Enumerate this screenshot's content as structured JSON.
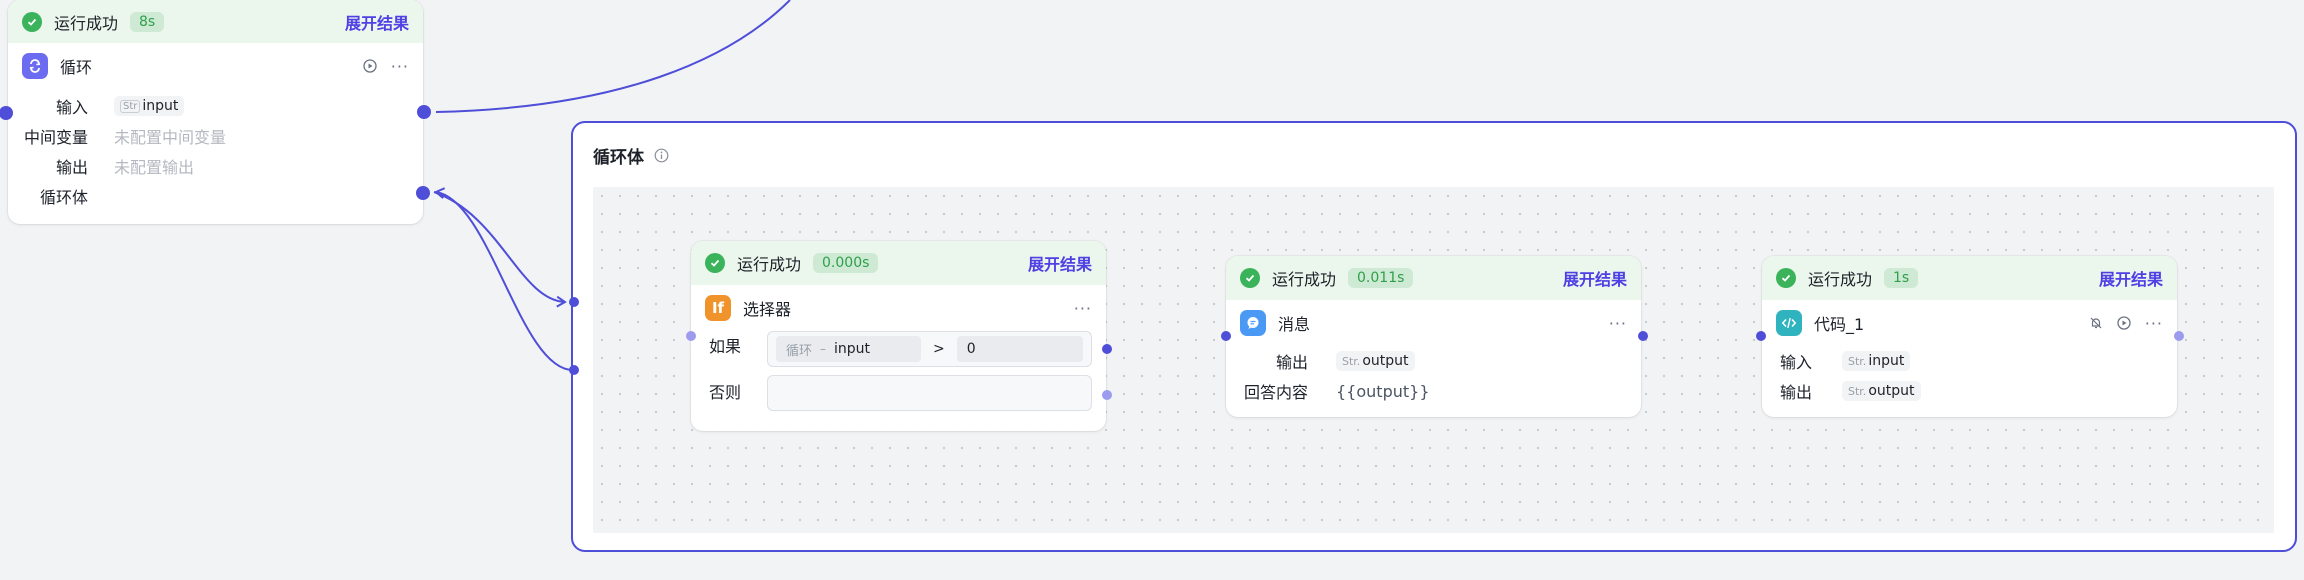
{
  "status": {
    "success_text": "运行成功",
    "expand_label": "展开结果"
  },
  "loop_node": {
    "duration": "8s",
    "title": "循环",
    "rows": {
      "input_label": "输入",
      "input_type": "Str",
      "input_value": "input",
      "mid_label": "中间变量",
      "mid_value": "未配置中间变量",
      "output_label": "输出",
      "output_value": "未配置输出",
      "body_label": "循环体"
    }
  },
  "loop_body": {
    "title": "循环体"
  },
  "selector_node": {
    "duration": "0.000s",
    "icon_text": "If",
    "title": "选择器",
    "if_label": "如果",
    "cond_var_scope": "循环",
    "cond_var_sep": "–",
    "cond_var_name": "input",
    "cond_op": ">",
    "cond_value": "0",
    "else_label": "否则"
  },
  "message_node": {
    "duration": "0.011s",
    "title": "消息",
    "output_label": "输出",
    "output_type": "Str.",
    "output_value": "output",
    "answer_label": "回答内容",
    "answer_value": "{{output}}"
  },
  "code_node": {
    "duration": "1s",
    "title": "代码_1",
    "input_label": "输入",
    "input_type": "Str.",
    "input_value": "input",
    "output_label": "输出",
    "output_type": "Str.",
    "output_value": "output"
  },
  "colors": {
    "accent": "#4e4ed8",
    "success": "#3bb35a",
    "success_bg": "#ebf6ec",
    "loop_icon": "#6c6cf0",
    "if_icon": "#f0932b",
    "msg_icon": "#4a9af5",
    "code_icon": "#2fb3bf"
  },
  "icons": {
    "status": "check-circle-icon",
    "loop": "loop-icon",
    "if": "if-icon",
    "message": "chat-bubble-icon",
    "code": "code-icon",
    "info": "info-icon",
    "run": "play-circle-icon",
    "more": "more-dots-icon",
    "notify_off": "bell-off-icon"
  }
}
